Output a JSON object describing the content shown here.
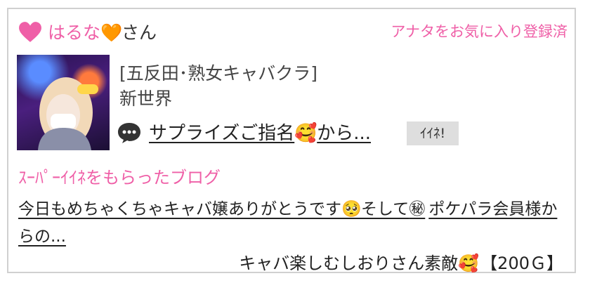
{
  "header": {
    "user_name": "はるな",
    "name_emoji": "🧡",
    "honorific": "さん",
    "favorite_status": "アナタをお気に入り登録済"
  },
  "shop": {
    "type": "[五反田･熟女キャバクラ]",
    "name": "新世界"
  },
  "review": {
    "text": "サプライズご指名",
    "emoji": "🥰",
    "suffix": "から...",
    "iine_label": "ｲｲﾈ!"
  },
  "blog": {
    "section_title": "ｽｰﾊﾟｰｲｲﾈをもらったブログ",
    "text_part1": "今日もめちゃくちゃキャバ嬢ありがとうです",
    "emoji1": "🥺",
    "text_part2": "そして",
    "emoji2": "㊙",
    "text_part3": "ポケパラ会員様からの...",
    "reward_text": "キャバ楽しむしおりさん素敵",
    "reward_emoji": "🥰",
    "reward_points": "【200Ｇ】"
  },
  "colors": {
    "accent_pink": "#ef5fa7",
    "button_gray": "#dedede",
    "border_gray": "#d0d0d0"
  },
  "icons": {
    "favorite": "heart-icon",
    "comment": "speech-bubble-icon"
  }
}
